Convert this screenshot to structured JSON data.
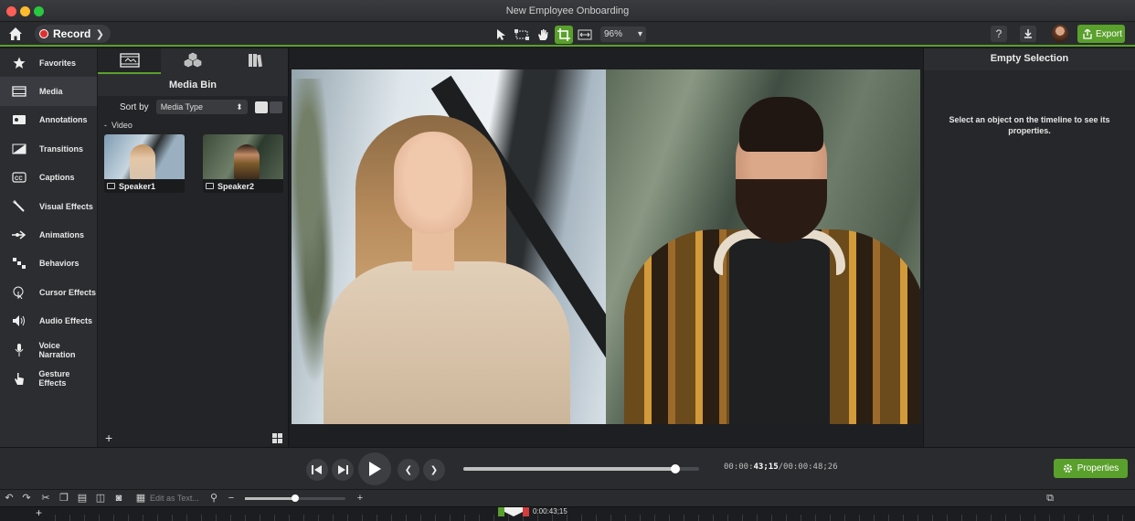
{
  "window": {
    "title": "New Employee Onboarding"
  },
  "toolbar": {
    "record_label": "Record",
    "zoom_value": "96%",
    "help_label": "?",
    "export_label": "Export"
  },
  "sidebar": {
    "items": [
      {
        "label": "Favorites",
        "icon": "star-icon"
      },
      {
        "label": "Media",
        "icon": "film-icon"
      },
      {
        "label": "Annotations",
        "icon": "annotation-icon"
      },
      {
        "label": "Transitions",
        "icon": "transition-icon"
      },
      {
        "label": "Captions",
        "icon": "captions-icon"
      },
      {
        "label": "Visual Effects",
        "icon": "wand-icon"
      },
      {
        "label": "Animations",
        "icon": "arrow-icon"
      },
      {
        "label": "Behaviors",
        "icon": "behaviors-icon"
      },
      {
        "label": "Cursor Effects",
        "icon": "cursor-icon"
      },
      {
        "label": "Audio Effects",
        "icon": "speaker-icon"
      },
      {
        "label": "Voice Narration",
        "icon": "microphone-icon"
      },
      {
        "label": "Gesture Effects",
        "icon": "hand-icon"
      }
    ],
    "active_index": 1
  },
  "media_bin": {
    "title": "Media Bin",
    "sort_label": "Sort by",
    "sort_value": "Media Type",
    "group_label": "Video",
    "items": [
      {
        "label": "Speaker1"
      },
      {
        "label": "Speaker2"
      }
    ],
    "add_label": "+"
  },
  "properties": {
    "title": "Empty Selection",
    "message": "Select an object on the timeline to see its properties.",
    "button_label": "Properties"
  },
  "playback": {
    "time_current_prefix": "00:00:",
    "time_current_bold": "43;15",
    "time_total": "/00:00:48;26",
    "progress_fraction": 0.9
  },
  "timeline": {
    "edit_as_text": "Edit as Text...",
    "playhead_time": "0:00:43;15",
    "zoom_fraction": 0.5
  },
  "colors": {
    "accent": "#5aa02c",
    "record": "#e02e2e",
    "playhead_end": "#d23c3c"
  }
}
